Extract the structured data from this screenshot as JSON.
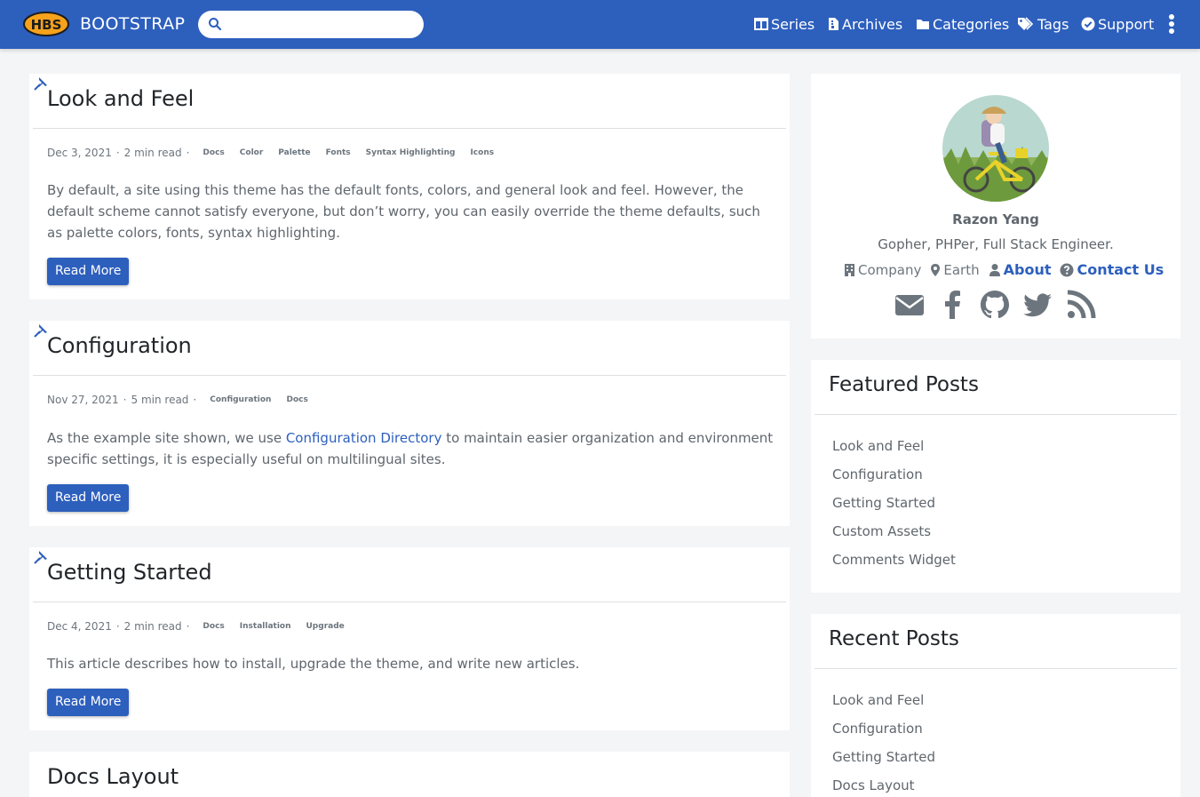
{
  "navbar": {
    "brand": "BOOTSTRAP",
    "logo_text": "HBS",
    "search_placeholder": "",
    "items": [
      {
        "label": "Series",
        "icon": "columns-icon"
      },
      {
        "label": "Archives",
        "icon": "file-archive-icon"
      },
      {
        "label": "Categories",
        "icon": "folder-icon"
      },
      {
        "label": "Tags",
        "icon": "tags-icon"
      },
      {
        "label": "Support",
        "icon": "check-circle-icon"
      }
    ],
    "menu_icon": "ellipsis-vertical-icon"
  },
  "posts": [
    {
      "title": "Look and Feel",
      "date": "Dec 3, 2021",
      "read_time": "2 min read",
      "tags": [
        "Docs",
        "Color",
        "Palette",
        "Fonts",
        "Syntax Highlighting",
        "Icons"
      ],
      "summary": "By default, a site using this theme has the default fonts, colors, and general look and feel. However, the default scheme cannot satisfy everyone, but don’t worry, you can easily override the theme defaults, such as palette colors, fonts, syntax highlighting.",
      "button": "Read More",
      "pinned": true
    },
    {
      "title": "Configuration",
      "date": "Nov 27, 2021",
      "read_time": "5 min read",
      "tags": [
        "Configuration",
        "Docs"
      ],
      "summary_before": "As the example site shown, we use ",
      "summary_link": "Configuration Directory",
      "summary_after": " to maintain easier organization and environment specific settings, it is especially useful on multilingual sites.",
      "button": "Read More",
      "pinned": true
    },
    {
      "title": "Getting Started",
      "date": "Dec 4, 2021",
      "read_time": "2 min read",
      "tags": [
        "Docs",
        "Installation",
        "Upgrade"
      ],
      "summary": "This article describes how to install, upgrade the theme, and write new articles.",
      "button": "Read More",
      "pinned": true
    },
    {
      "title": "Docs Layout",
      "pinned": false
    }
  ],
  "profile": {
    "name": "Razon Yang",
    "bio": "Gopher, PHPer, Full Stack Engineer.",
    "company": "Company",
    "location": "Earth",
    "about": "About",
    "contact": "Contact Us",
    "social": [
      "envelope-icon",
      "facebook-icon",
      "github-icon",
      "twitter-icon",
      "rss-icon"
    ]
  },
  "featured": {
    "title": "Featured Posts",
    "items": [
      "Look and Feel",
      "Configuration",
      "Getting Started",
      "Custom Assets",
      "Comments Widget"
    ]
  },
  "recent": {
    "title": "Recent Posts",
    "items": [
      "Look and Feel",
      "Configuration",
      "Getting Started",
      "Docs Layout"
    ]
  },
  "colors": {
    "primary": "#2d5fbd",
    "background": "#f4f5f7",
    "text_muted": "#5f666d"
  }
}
